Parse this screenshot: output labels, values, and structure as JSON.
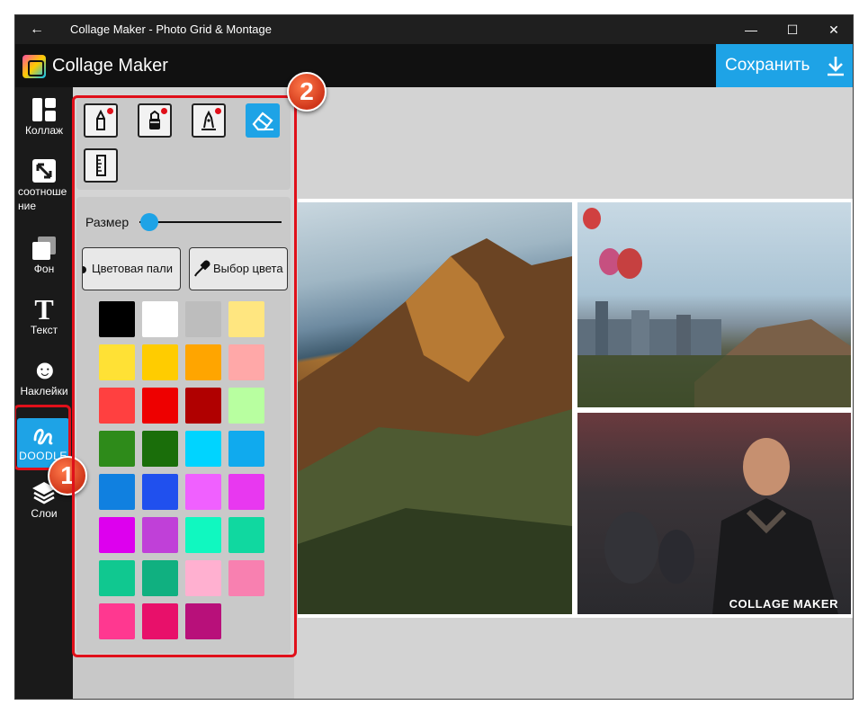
{
  "titlebar": {
    "back": "←",
    "title": "Collage Maker - Photo Grid & Montage",
    "minimize": "—",
    "maximize": "☐",
    "close": "✕"
  },
  "appbar": {
    "title": "Collage Maker",
    "save_label": "Сохранить"
  },
  "nav": {
    "items": [
      {
        "label": "Коллаж",
        "icon": "collage-icon"
      },
      {
        "label": "соотношение",
        "icon": "resize-icon"
      },
      {
        "label": "Фон",
        "icon": "background-icon"
      },
      {
        "label": "Текст",
        "icon": "text-icon",
        "glyph": "T"
      },
      {
        "label": "Наклейки",
        "icon": "sticker-icon",
        "glyph": "☻"
      },
      {
        "label": "DOODLE",
        "icon": "doodle-icon",
        "active": true
      },
      {
        "label": "Слои",
        "icon": "layers-icon"
      }
    ]
  },
  "badges": {
    "one": "1",
    "two": "2"
  },
  "panel": {
    "tools": [
      "pencil-icon",
      "marker-icon",
      "pen-icon",
      "eraser-icon",
      "ruler-icon"
    ],
    "size_label": "Размер",
    "size_value": 0.05,
    "palette_btn": "Цветовая пали",
    "picker_btn": "Выбор цвета",
    "colors": [
      "#000000",
      "#ffffff",
      "#bdbdbd",
      "#ffe680",
      "#ffe135",
      "#ffcc00",
      "#ffa500",
      "#ffa8a8",
      "#ff4040",
      "#ee0000",
      "#b00000",
      "#b8ffa0",
      "#2e8b1a",
      "#1a6e0a",
      "#00d4ff",
      "#10aaee",
      "#1080e0",
      "#2050ee",
      "#f060ff",
      "#e838f0",
      "#dd00ee",
      "#c040d8",
      "#10f8c0",
      "#10d8a0",
      "#10c890",
      "#10b080",
      "#ffb0d0",
      "#f880b0",
      "#ff3890",
      "#e8106a",
      "#b8107a"
    ]
  },
  "collage": {
    "watermark": "COLLAGE MAKER"
  },
  "colors": {
    "accent": "#1ea3e6",
    "highlight": "#e0101a"
  }
}
